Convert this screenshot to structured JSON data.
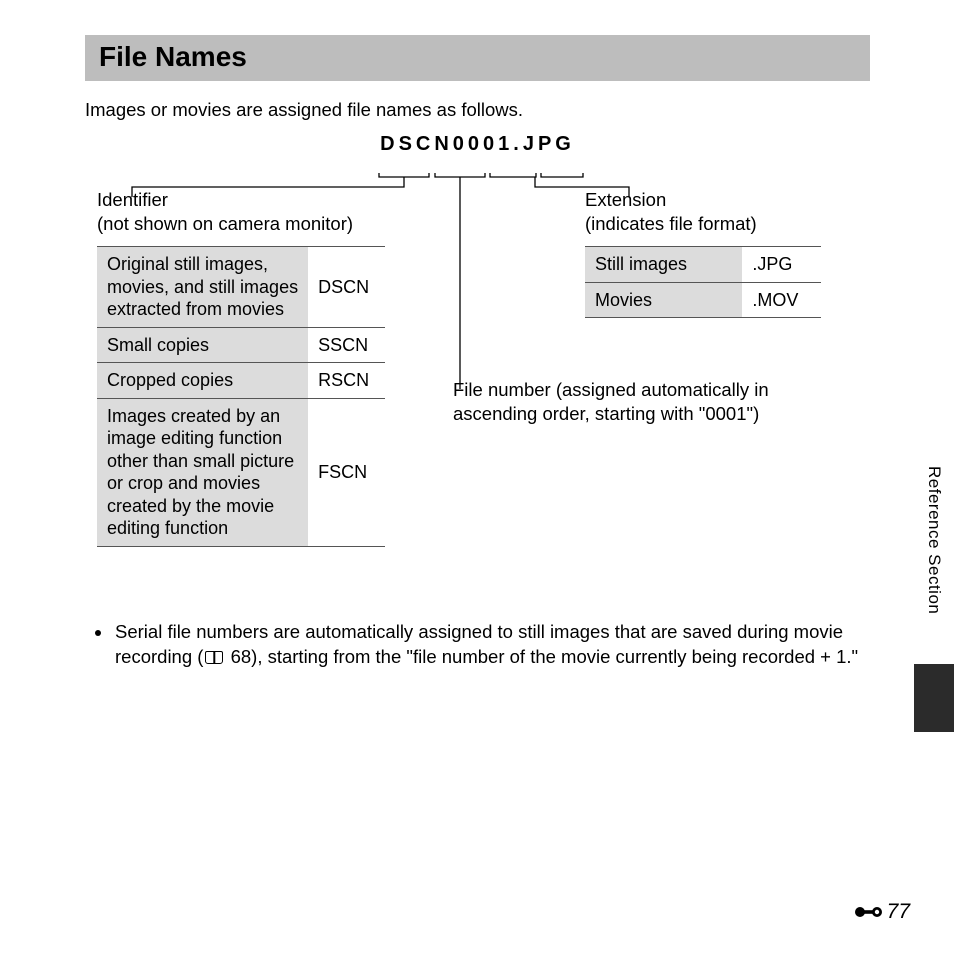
{
  "heading": "File Names",
  "intro": "Images or movies are assigned file names as follows.",
  "example_filename": "DSCN0001.JPG",
  "identifier": {
    "title_line1": "Identifier",
    "title_line2": "(not shown on camera monitor)",
    "rows": [
      {
        "desc": "Original still images, movies, and still images extracted from movies",
        "code": "DSCN"
      },
      {
        "desc": "Small copies",
        "code": "SSCN"
      },
      {
        "desc": "Cropped copies",
        "code": "RSCN"
      },
      {
        "desc": "Images created by an image editing function other than small picture or crop and movies created by the movie editing function",
        "code": "FSCN"
      }
    ]
  },
  "extension": {
    "title_line1": "Extension",
    "title_line2": "(indicates file format)",
    "rows": [
      {
        "desc": "Still images",
        "code": ".JPG"
      },
      {
        "desc": "Movies",
        "code": ".MOV"
      }
    ]
  },
  "file_number_label": "File number (assigned automatically in ascending order, starting with \"0001\")",
  "bullet_before": "Serial file numbers are automatically assigned to still images that are saved during movie recording (",
  "bullet_ref": "68",
  "bullet_after": "), starting from the \"file number of the movie currently being recorded + 1.\"",
  "side_tab": "Reference Section",
  "page_number": "77"
}
